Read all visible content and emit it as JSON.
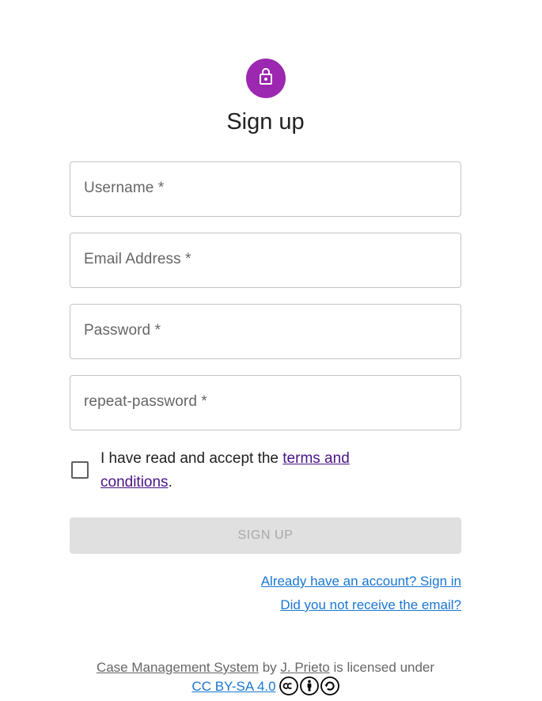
{
  "page": {
    "title": "Sign up",
    "icon": "lock-icon",
    "accent_color": "#9c27b0"
  },
  "form": {
    "username_label": "Username *",
    "email_label": "Email Address *",
    "password_label": "Password *",
    "repeat_password_label": "repeat-password *",
    "terms_prefix": "I have read and accept the ",
    "terms_link": "terms and conditions",
    "terms_suffix": ".",
    "terms_checked": false,
    "submit_label": "SIGN UP",
    "submit_disabled": true
  },
  "links": {
    "sign_in": "Already have an account? Sign in",
    "resend_email": "Did you not receive the email?"
  },
  "footer": {
    "work_title": "Case Management System",
    "by": " by ",
    "author": "J. Prieto",
    "licensed_text": " is licensed under",
    "license": "CC BY-SA 4.0",
    "license_icons": [
      "cc-icon",
      "by-icon",
      "sa-icon"
    ]
  }
}
